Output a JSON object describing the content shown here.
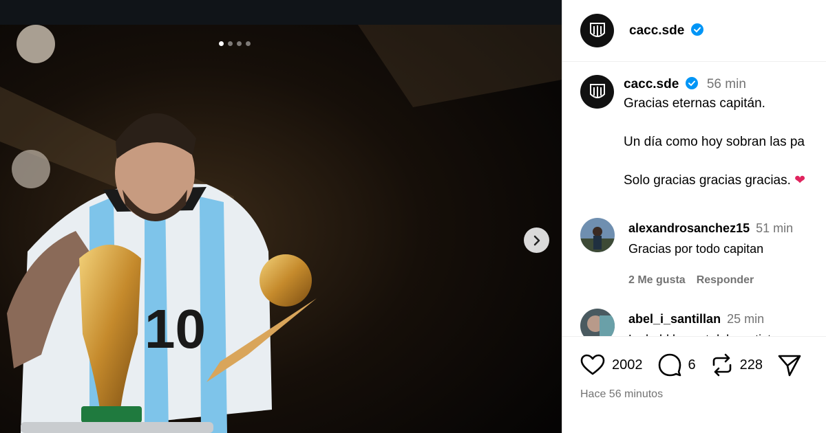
{
  "post": {
    "username": "cacc.sde",
    "media": {
      "slide_count": 4,
      "active_slide": 1
    }
  },
  "caption": {
    "username": "cacc.sde",
    "time": "56 min",
    "lines": [
      "Gracias eternas capitán.",
      "Un día como hoy sobran las pa",
      "Solo gracias gracias gracias. "
    ]
  },
  "comments": [
    {
      "username": "alexandrosanchez15",
      "time": "51 min",
      "text": "Gracias por todo capitan",
      "likes": "2 Me gusta",
      "reply": "Responder"
    },
    {
      "username": "abel_i_santillan",
      "time": "25 min",
      "text": "La hold le gust del y estist"
    }
  ],
  "actions": {
    "likes": "2002",
    "comments": "6",
    "reposts": "228"
  },
  "timestamp": "Hace 56 minutos",
  "colors": {
    "verified": "#0095f6",
    "secondary_text": "#737373",
    "heart": "#e0245e"
  },
  "icons": [
    "heart-icon",
    "comment-icon",
    "repost-icon",
    "share-icon",
    "verified-icon",
    "chevron-right-icon"
  ]
}
